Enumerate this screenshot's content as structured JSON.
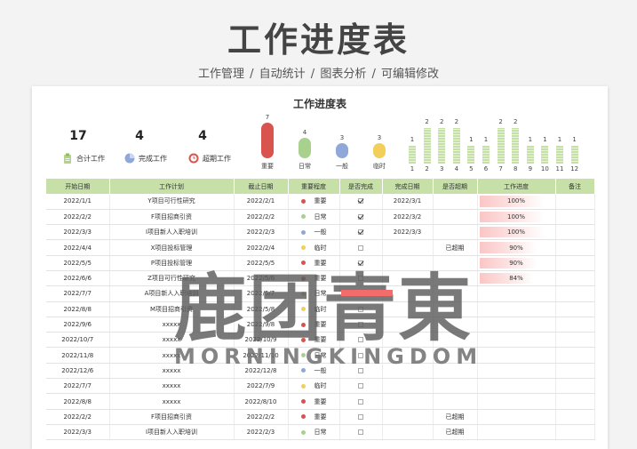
{
  "page": {
    "title": "工作进度表",
    "subtitle": "工作管理 / 自动统计 / 图表分析 / 可编辑修改"
  },
  "sheet": {
    "title": "工作进度表"
  },
  "kpis": [
    {
      "value": "17",
      "label": "合计工作",
      "icon": "clipboard-icon",
      "color": "#b4d38a"
    },
    {
      "value": "4",
      "label": "完成工作",
      "icon": "pie-icon",
      "color": "#8fa8d9"
    },
    {
      "value": "4",
      "label": "超期工作",
      "icon": "clock-icon",
      "color": "#d9534f"
    }
  ],
  "importance_chart": [
    {
      "label": "重要",
      "count": 7,
      "color": "#d9534f"
    },
    {
      "label": "日常",
      "count": 4,
      "color": "#a9d18e"
    },
    {
      "label": "一般",
      "count": 3,
      "color": "#8fa8d9"
    },
    {
      "label": "临时",
      "count": 3,
      "color": "#f2cf5b"
    }
  ],
  "monthly_chart": {
    "months": [
      "1",
      "2",
      "3",
      "4",
      "5",
      "6",
      "7",
      "8",
      "9",
      "10",
      "11",
      "12"
    ],
    "values": [
      1,
      2,
      2,
      2,
      1,
      1,
      2,
      2,
      1,
      1,
      1,
      1
    ],
    "color": "#c6e0a8"
  },
  "table": {
    "headers": [
      "开始日期",
      "工作计划",
      "截止日期",
      "重要程度",
      "是否完成",
      "完成日期",
      "是否超期",
      "工作进度",
      "备注"
    ],
    "rows": [
      {
        "start": "2022/1/1",
        "plan": "Y项目可行性研究",
        "due": "2022/2/1",
        "level": "重要",
        "done": true,
        "done_date": "2022/3/1",
        "overdue": "",
        "progress": "100%"
      },
      {
        "start": "2022/2/2",
        "plan": "F项目招商引资",
        "due": "2022/2/2",
        "level": "日常",
        "done": true,
        "done_date": "2022/3/2",
        "overdue": "",
        "progress": "100%"
      },
      {
        "start": "2022/3/3",
        "plan": "I项目新人入职培训",
        "due": "2022/2/3",
        "level": "一般",
        "done": true,
        "done_date": "2022/3/3",
        "overdue": "",
        "progress": "100%"
      },
      {
        "start": "2022/4/4",
        "plan": "X项目投标管理",
        "due": "2022/2/4",
        "level": "临时",
        "done": false,
        "done_date": "",
        "overdue": "已超期",
        "progress": "90%"
      },
      {
        "start": "2022/5/5",
        "plan": "P项目投标管理",
        "due": "2022/5/5",
        "level": "重要",
        "done": true,
        "done_date": "",
        "overdue": "",
        "progress": "90%"
      },
      {
        "start": "2022/6/6",
        "plan": "Z项目可行性研究",
        "due": "2022/5/6",
        "level": "重要",
        "done": false,
        "done_date": "",
        "overdue": "",
        "progress": "84%"
      },
      {
        "start": "2022/7/7",
        "plan": "A项目新人入职培训",
        "due": "2022/5/7",
        "level": "日常",
        "done": false,
        "done_date": "",
        "overdue": "",
        "progress": ""
      },
      {
        "start": "2022/8/8",
        "plan": "M项目招商引资",
        "due": "2022/5/8",
        "level": "临时",
        "done": false,
        "done_date": "",
        "overdue": "",
        "progress": ""
      },
      {
        "start": "2022/9/6",
        "plan": "xxxxx",
        "due": "2022/9/8",
        "level": "重要",
        "done": false,
        "done_date": "",
        "overdue": "",
        "progress": ""
      },
      {
        "start": "2022/10/7",
        "plan": "xxxxx",
        "due": "2022/10/9",
        "level": "重要",
        "done": false,
        "done_date": "",
        "overdue": "",
        "progress": ""
      },
      {
        "start": "2022/11/8",
        "plan": "xxxxx",
        "due": "2022/11/10",
        "level": "日常",
        "done": false,
        "done_date": "",
        "overdue": "",
        "progress": ""
      },
      {
        "start": "2022/12/6",
        "plan": "xxxxx",
        "due": "2022/12/8",
        "level": "一般",
        "done": false,
        "done_date": "",
        "overdue": "",
        "progress": ""
      },
      {
        "start": "2022/7/7",
        "plan": "xxxxx",
        "due": "2022/7/9",
        "level": "临时",
        "done": false,
        "done_date": "",
        "overdue": "",
        "progress": ""
      },
      {
        "start": "2022/8/8",
        "plan": "xxxxx",
        "due": "2022/8/10",
        "level": "重要",
        "done": false,
        "done_date": "",
        "overdue": "",
        "progress": ""
      },
      {
        "start": "2022/2/2",
        "plan": "F项目招商引资",
        "due": "2022/2/2",
        "level": "重要",
        "done": false,
        "done_date": "",
        "overdue": "已超期",
        "progress": ""
      },
      {
        "start": "2022/3/3",
        "plan": "I项目新人入职培训",
        "due": "2022/2/3",
        "level": "日常",
        "done": false,
        "done_date": "",
        "overdue": "已超期",
        "progress": ""
      }
    ],
    "level_colors": {
      "重要": "#d9534f",
      "日常": "#a9d18e",
      "一般": "#8fa8d9",
      "临时": "#f2cf5b"
    }
  },
  "watermark": {
    "big": "鹿团青東",
    "small": "MORNINGKINGDOM"
  }
}
